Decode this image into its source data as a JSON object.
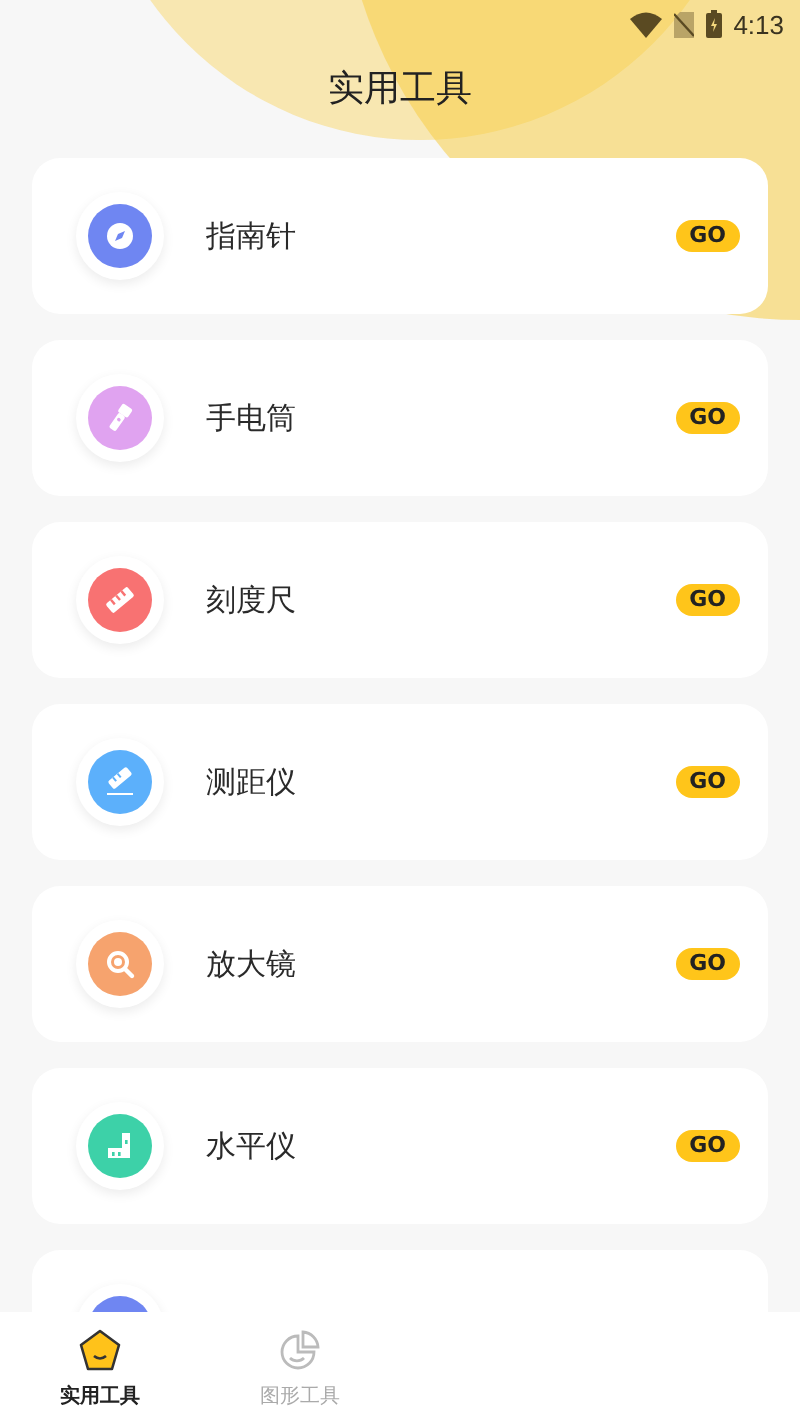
{
  "status_bar": {
    "time": "4:13"
  },
  "header": {
    "title": "实用工具"
  },
  "tools": [
    {
      "label": "指南针",
      "action": "GO",
      "color": "#6f86f2"
    },
    {
      "label": "手电筒",
      "action": "GO",
      "color": "#e0a3f0"
    },
    {
      "label": "刻度尺",
      "action": "GO",
      "color": "#f87272"
    },
    {
      "label": "测距仪",
      "action": "GO",
      "color": "#5cb0fb"
    },
    {
      "label": "放大镜",
      "action": "GO",
      "color": "#f6a36e"
    },
    {
      "label": "水平仪",
      "action": "GO",
      "color": "#3dd1a8"
    },
    {
      "color": "#6f86f2"
    }
  ],
  "tab_bar": [
    {
      "label": "实用工具",
      "selected": true
    },
    {
      "label": "图形工具",
      "selected": false
    }
  ]
}
